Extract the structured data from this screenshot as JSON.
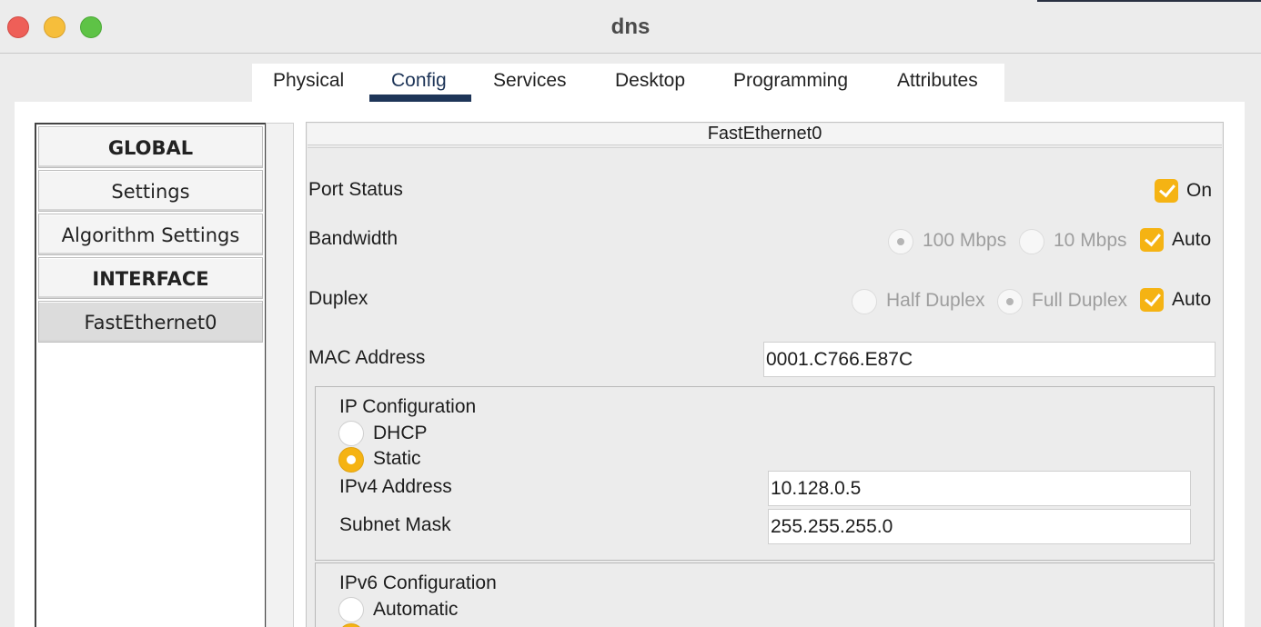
{
  "window": {
    "title": "dns"
  },
  "tabs": [
    {
      "label": "Physical"
    },
    {
      "label": "Config"
    },
    {
      "label": "Services"
    },
    {
      "label": "Desktop"
    },
    {
      "label": "Programming"
    },
    {
      "label": "Attributes"
    }
  ],
  "active_tab": "Config",
  "sidebar": {
    "items": [
      {
        "label": "GLOBAL",
        "type": "header"
      },
      {
        "label": "Settings",
        "type": "item"
      },
      {
        "label": "Algorithm Settings",
        "type": "item"
      },
      {
        "label": "INTERFACE",
        "type": "header"
      },
      {
        "label": "FastEthernet0",
        "type": "item",
        "selected": true
      }
    ]
  },
  "panel": {
    "title": "FastEthernet0",
    "port_status": {
      "label": "Port Status",
      "on_label": "On",
      "checked": true
    },
    "bandwidth": {
      "label": "Bandwidth",
      "option_100": "100 Mbps",
      "option_10": "10 Mbps",
      "auto_label": "Auto",
      "auto_checked": true
    },
    "duplex": {
      "label": "Duplex",
      "half": "Half Duplex",
      "full": "Full Duplex",
      "auto_label": "Auto",
      "auto_checked": true
    },
    "mac": {
      "label": "MAC Address",
      "value": "0001.C766.E87C"
    },
    "ipv4_config": {
      "title": "IP Configuration",
      "dhcp": "DHCP",
      "static": "Static",
      "selected": "Static",
      "address_label": "IPv4 Address",
      "address_value": "10.128.0.5",
      "mask_label": "Subnet Mask",
      "mask_value": "255.255.255.0"
    },
    "ipv6_config": {
      "title": "IPv6 Configuration",
      "automatic": "Automatic"
    }
  },
  "colors": {
    "accent": "#f5b313",
    "tab_underline": "#1e3558",
    "close": "#ee5f58",
    "minimize": "#f6be3b",
    "zoom": "#5ec346"
  },
  "icons": [
    "close-window-icon",
    "minimize-window-icon",
    "zoom-window-icon",
    "checkmark-icon"
  ]
}
